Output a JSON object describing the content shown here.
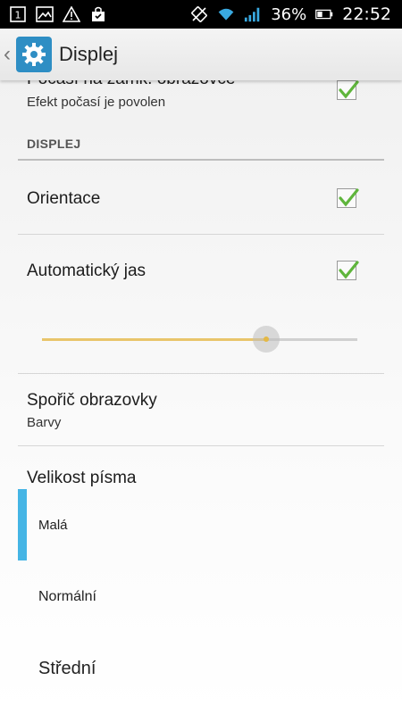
{
  "status_bar": {
    "notification_icons": [
      "notification-count-icon",
      "image-icon",
      "warning-icon",
      "store-bag-icon"
    ],
    "notification_count": "1",
    "battery_percent": "36%",
    "time": "22:52"
  },
  "action_bar": {
    "title": "Displej",
    "app_icon": "gear-icon"
  },
  "prefs": {
    "weather": {
      "title": "Počasí na zámk. obrazovce",
      "summary": "Efekt počasí je povolen",
      "checked": true
    },
    "section_display": "DISPLEJ",
    "orientation": {
      "title": "Orientace",
      "checked": true
    },
    "auto_brightness": {
      "title": "Automatický jas",
      "checked": true,
      "level": 0.71
    },
    "screensaver": {
      "title": "Spořič obrazovky",
      "summary": "Barvy"
    },
    "font_size": {
      "title": "Velikost písma",
      "options": [
        "Malá",
        "Normální",
        "Střední"
      ],
      "selected": "Malá"
    }
  },
  "colors": {
    "accent_selected": "#45b5e5",
    "checkmark": "#5fb53c",
    "slider_fill": "#e9c56b",
    "app_icon_bg": "#2e8ec4"
  }
}
